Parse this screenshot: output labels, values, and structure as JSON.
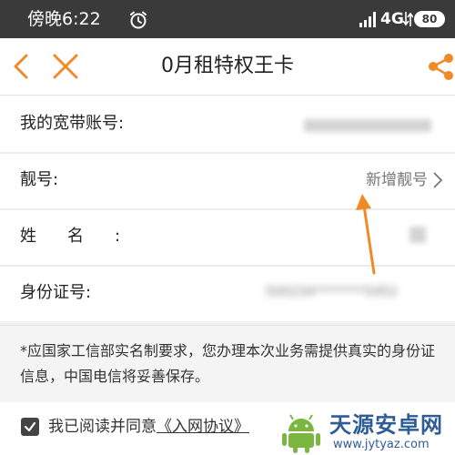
{
  "status_bar": {
    "time": "傍晚6:22",
    "network": "4G",
    "battery": "80"
  },
  "nav": {
    "title": "0月租特权王卡"
  },
  "form": {
    "broadband_label": "我的宽带账号:",
    "broadband_value": "",
    "pretty_number_label": "靓号:",
    "pretty_number_action": "新增靓号",
    "name_label": "姓名:",
    "id_label": "身份证号:",
    "id_value": "500234********5452"
  },
  "notice": {
    "text": "*应国家工信部实名制要求，您办理本次业务需提供真实的身份证信息，中国电信将妥善保存。"
  },
  "agreement": {
    "checked": true,
    "prefix": "我已阅读并同意",
    "link": "《入网协议》"
  },
  "watermark": {
    "title": "天源安卓网",
    "url": "www.jytyaz.com"
  },
  "colors": {
    "accent": "#f08a24",
    "status_bar_bg": "#3a3a3a",
    "watermark": "#2e5d96"
  },
  "icons": {
    "back": "chevron-left-icon",
    "close": "close-icon",
    "share": "share-icon",
    "alarm": "alarm-clock-icon",
    "signal": "signal-icon",
    "wifi": "wifi-icon",
    "chevron": "chevron-right-icon",
    "checkbox": "checkbox-checked-icon"
  }
}
